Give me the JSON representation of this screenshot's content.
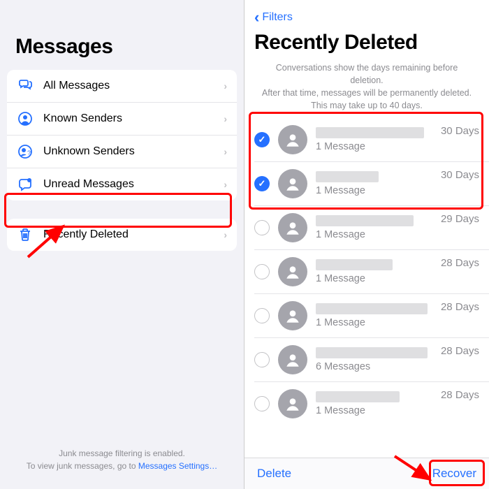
{
  "left": {
    "title": "Messages",
    "filters": [
      {
        "label": "All Messages"
      },
      {
        "label": "Known Senders"
      },
      {
        "label": "Unknown Senders"
      },
      {
        "label": "Unread Messages"
      }
    ],
    "recent": {
      "label": "Recently Deleted"
    },
    "footer": {
      "line1": "Junk message filtering is enabled.",
      "line2_prefix": "To view junk messages, go to ",
      "line2_link": "Messages Settings…"
    }
  },
  "right": {
    "back_label": "Filters",
    "title": "Recently Deleted",
    "info_line1": "Conversations show the days remaining before deletion.",
    "info_line2": "After that time, messages will be permanently deleted.",
    "info_line3": "This may take up to 40 days.",
    "items": [
      {
        "selected": true,
        "count_label": "1 Message",
        "days_label": "30 Days",
        "name_w": 155
      },
      {
        "selected": true,
        "count_label": "1 Message",
        "days_label": "30 Days",
        "name_w": 90
      },
      {
        "selected": false,
        "count_label": "1 Message",
        "days_label": "29 Days",
        "name_w": 140
      },
      {
        "selected": false,
        "count_label": "1 Message",
        "days_label": "28 Days",
        "name_w": 110
      },
      {
        "selected": false,
        "count_label": "1 Message",
        "days_label": "28 Days",
        "name_w": 160
      },
      {
        "selected": false,
        "count_label": "6 Messages",
        "days_label": "28 Days",
        "name_w": 160
      },
      {
        "selected": false,
        "count_label": "1 Message",
        "days_label": "28 Days",
        "name_w": 120
      }
    ],
    "toolbar": {
      "delete": "Delete",
      "recover": "Recover"
    }
  }
}
